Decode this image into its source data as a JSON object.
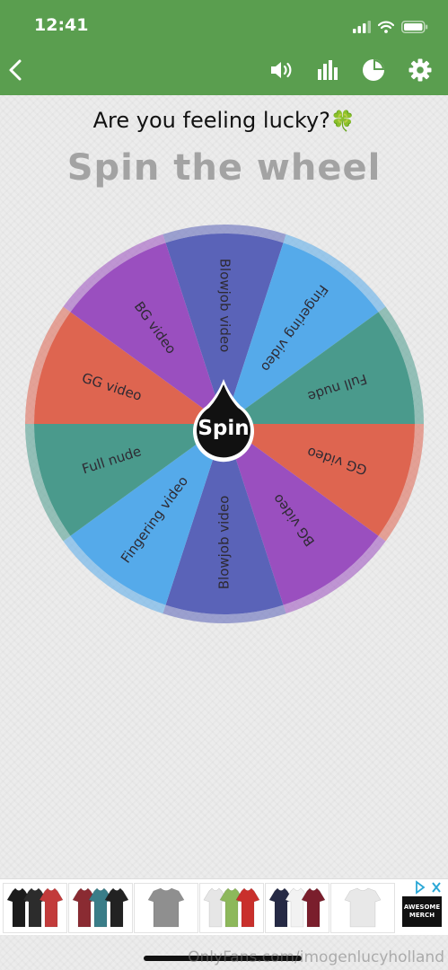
{
  "status_bar": {
    "time": "12:41"
  },
  "nav": {
    "icons": [
      "back-icon",
      "sound-icon",
      "stats-icon",
      "pie-chart-icon",
      "settings-icon"
    ]
  },
  "headline": "Are you feeling lucky?",
  "headline_emoji": "🍀",
  "title": "Spin the wheel",
  "wheel": {
    "center_label": "Spin",
    "segments": [
      {
        "label": "Blowjob video",
        "color": "#5a63b8"
      },
      {
        "label": "Fingering video",
        "color": "#55aaea"
      },
      {
        "label": "Full nude",
        "color": "#4a9a8c"
      },
      {
        "label": "GG video",
        "color": "#de6550"
      },
      {
        "label": "BG video",
        "color": "#9a4fbf"
      },
      {
        "label": "Blowjob video",
        "color": "#5a63b8"
      },
      {
        "label": "Fingering video",
        "color": "#55aaea"
      },
      {
        "label": "Full nude",
        "color": "#4a9a8c"
      },
      {
        "label": "GG video",
        "color": "#de6550"
      },
      {
        "label": "BG video",
        "color": "#9a4fbf"
      }
    ]
  },
  "ad": {
    "logo_text": "AWESOME MERCH",
    "shirt_sets": [
      [
        "#1c1c1c",
        "#2c2c2c",
        "#c23b3b"
      ],
      [
        "#8a2b32",
        "#3a7d88",
        "#222222"
      ],
      [
        "#8f8f8f"
      ],
      [
        "#e6e6e6",
        "#8db85b",
        "#c9302c"
      ],
      [
        "#262a45",
        "#f2f2f2",
        "#7a1e2c"
      ],
      [
        "#e8e8e8"
      ]
    ]
  },
  "watermark": "OnlyFans.com/imogenlucyholland",
  "colors": {
    "header": "#5a9e4f",
    "title": "#a3a3a3"
  }
}
